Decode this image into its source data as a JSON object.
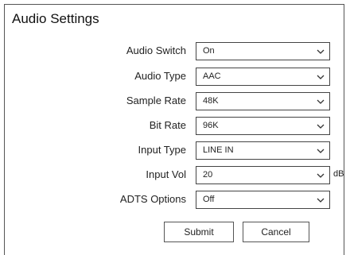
{
  "panel": {
    "title": "Audio Settings"
  },
  "fields": [
    {
      "label": "Audio Switch",
      "value": "On"
    },
    {
      "label": "Audio Type",
      "value": "AAC"
    },
    {
      "label": "Sample Rate",
      "value": "48K"
    },
    {
      "label": "Bit Rate",
      "value": "96K"
    },
    {
      "label": "Input Type",
      "value": "LINE IN"
    },
    {
      "label": "Input Vol",
      "value": "20",
      "unit": "dB"
    },
    {
      "label": "ADTS Options",
      "value": "Off"
    }
  ],
  "buttons": {
    "submit_label": "Submit",
    "cancel_label": "Cancel"
  },
  "icons": {
    "dropdown": "chevron-down-icon"
  },
  "colors": {
    "border": "#444444",
    "text": "#222222",
    "background": "#ffffff"
  }
}
